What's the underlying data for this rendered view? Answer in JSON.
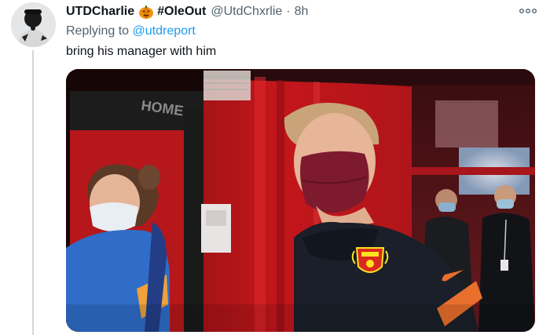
{
  "tweet": {
    "display_name": "UTDCharlie",
    "emoji_icon": "pumpkin-emoji",
    "hashtag_name": "#OleOut",
    "handle": "@UtdChxrlie",
    "separator": "·",
    "timestamp": "8h",
    "replying_prefix": "Replying to",
    "replying_to": "@utdreport",
    "text": "bring his manager with him",
    "more_icon": "more-options-icon"
  },
  "media": {
    "sign_text": "HOME",
    "crest_colors": {
      "red": "#da291c",
      "yellow": "#fbe122"
    },
    "photo_subject": "tunnel-photo"
  },
  "colors": {
    "text_primary": "#0f1419",
    "text_secondary": "#536471",
    "link": "#1d9bf0",
    "thread_line": "#cfd9de"
  }
}
